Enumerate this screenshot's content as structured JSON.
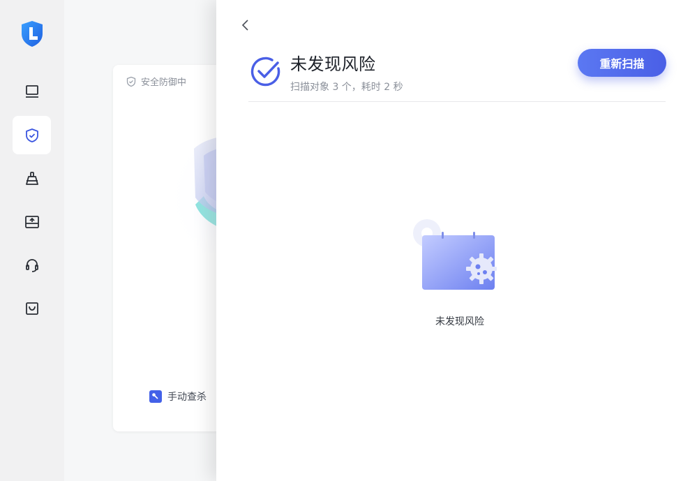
{
  "sidebar": {
    "logo_icon": "shield-logo-icon",
    "items": [
      {
        "name": "monitor",
        "icon": "monitor-icon",
        "active": false
      },
      {
        "name": "security",
        "icon": "shield-check-icon",
        "active": true
      },
      {
        "name": "cleanup",
        "icon": "broom-icon",
        "active": false
      },
      {
        "name": "storage",
        "icon": "drive-upload-icon",
        "active": false
      },
      {
        "name": "support",
        "icon": "headset-icon",
        "active": false
      },
      {
        "name": "store",
        "icon": "bag-icon",
        "active": false
      }
    ]
  },
  "background": {
    "status_label": "安全防御中",
    "manual_scan_label": "手动查杀"
  },
  "drawer": {
    "title": "未发现风险",
    "subtitle": "扫描对象 3 个，耗时 2 秒",
    "rescan_label": "重新扫描",
    "empty_text": "未发现风险"
  },
  "colors": {
    "accent": "#4a5fe6",
    "accent_light": "#5b78f2",
    "sidebar_bg": "#f1f1f2",
    "text_primary": "#1d2129",
    "text_secondary": "#8a8f99"
  }
}
